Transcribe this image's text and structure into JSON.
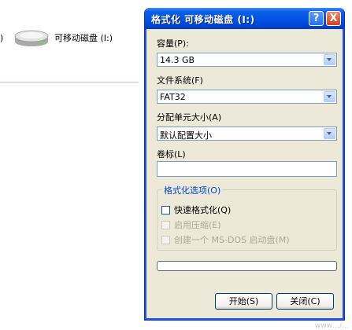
{
  "background": {
    "paren": ")",
    "drive_label": "可移动磁盘 (I:)",
    "watermark": "www…/…"
  },
  "dialog": {
    "title": "格式化 可移动磁盘 (I:)",
    "help_button": "?",
    "close_button": "X",
    "capacity": {
      "label": "容量(P):",
      "value": "14.3 GB"
    },
    "filesystem": {
      "label": "文件系统(F)",
      "value": "FAT32"
    },
    "allocation": {
      "label": "分配单元大小(A)",
      "value": "默认配置大小"
    },
    "volume": {
      "label": "卷标(L)",
      "value": ""
    },
    "options": {
      "legend": "格式化选项(O)",
      "quick_format": {
        "label": "快速格式化(Q)",
        "checked": false,
        "enabled": true
      },
      "compression": {
        "label": "启用压缩(E)",
        "checked": false,
        "enabled": false
      },
      "msdos_disk": {
        "label": "创建一个 MS-DOS 启动盘(M)",
        "checked": false,
        "enabled": false
      }
    },
    "progress": 0,
    "start_button": "开始(S)",
    "close_label": "关闭(C)"
  }
}
